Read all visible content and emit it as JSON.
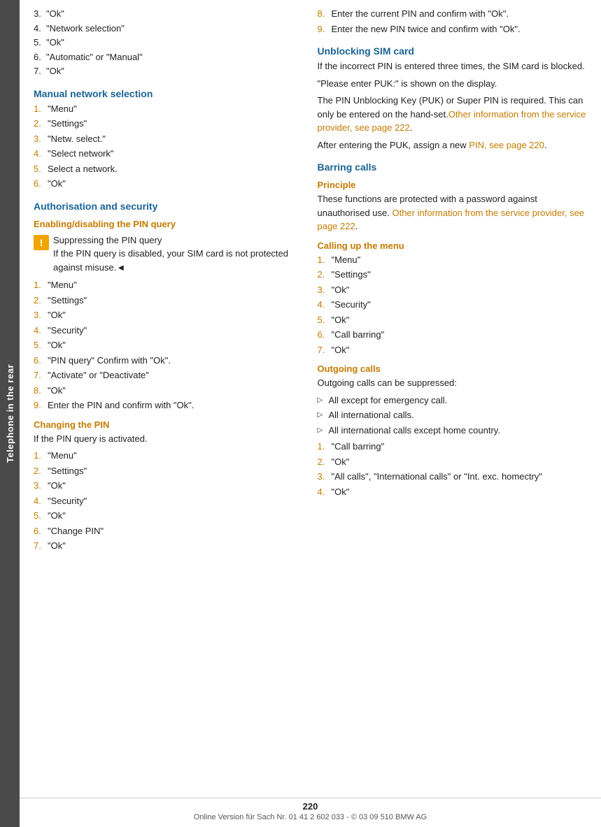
{
  "sidebar": {
    "label": "Telephone in the rear"
  },
  "footer": {
    "page_number": "220",
    "text": "Online Version für Sach Nr. 01 41 2 602 033 - © 03 09 510 BMW AG"
  },
  "left_col": {
    "top_list": {
      "items": [
        {
          "num": "3.",
          "text": "\"Ok\""
        },
        {
          "num": "4.",
          "text": "\"Network selection\""
        },
        {
          "num": "5.",
          "text": "\"Ok\""
        },
        {
          "num": "6.",
          "text": "\"Automatic\" or \"Manual\""
        },
        {
          "num": "7.",
          "text": "\"Ok\""
        }
      ]
    },
    "manual_network": {
      "heading": "Manual network selection",
      "items": [
        {
          "num": "1.",
          "text": "\"Menu\""
        },
        {
          "num": "2.",
          "text": "\"Settings\""
        },
        {
          "num": "3.",
          "text": "\"Netw. select.\""
        },
        {
          "num": "4.",
          "text": "\"Select network\""
        },
        {
          "num": "5.",
          "text": "Select a network."
        },
        {
          "num": "6.",
          "text": "\"Ok\""
        }
      ]
    },
    "auth_security": {
      "heading": "Authorisation and security"
    },
    "enabling_pin": {
      "heading": "Enabling/disabling the PIN query",
      "warning_line1": "Suppressing the PIN query",
      "warning_line2": "If the PIN query is disabled, your SIM card is not protected against misuse.◄",
      "items": [
        {
          "num": "1.",
          "text": "\"Menu\""
        },
        {
          "num": "2.",
          "text": "\"Settings\""
        },
        {
          "num": "3.",
          "text": "\"Ok\""
        },
        {
          "num": "4.",
          "text": "\"Security\""
        },
        {
          "num": "5.",
          "text": "\"Ok\""
        },
        {
          "num": "6.",
          "text": "\"PIN query\" Confirm with \"Ok\"."
        },
        {
          "num": "7.",
          "text": "\"Activate\" or \"Deactivate\""
        },
        {
          "num": "8.",
          "text": "\"Ok\""
        },
        {
          "num": "9.",
          "text": "Enter the PIN and confirm with \"Ok\"."
        }
      ]
    },
    "changing_pin": {
      "heading": "Changing the PIN",
      "intro": "If the PIN query is activated.",
      "items": [
        {
          "num": "1.",
          "text": "\"Menu\""
        },
        {
          "num": "2.",
          "text": "\"Settings\""
        },
        {
          "num": "3.",
          "text": "\"Ok\""
        },
        {
          "num": "4.",
          "text": "\"Security\""
        },
        {
          "num": "5.",
          "text": "\"Ok\""
        },
        {
          "num": "6.",
          "text": "\"Change PIN\""
        },
        {
          "num": "7.",
          "text": "\"Ok\""
        }
      ]
    }
  },
  "right_col": {
    "steps_8_9": {
      "items": [
        {
          "num": "8.",
          "text": "Enter the current PIN and confirm with \"Ok\"."
        },
        {
          "num": "9.",
          "text": "Enter the new PIN twice and confirm with \"Ok\"."
        }
      ]
    },
    "unblocking": {
      "heading": "Unblocking SIM card",
      "para1": "If the incorrect PIN is entered three times, the SIM card is blocked.",
      "para2": "\"Please enter PUK:\" is shown on the display.",
      "para3_start": "The PIN Unblocking Key (PUK) or Super PIN is required. This can only be entered on the hand-set.",
      "para3_link": "Other information from the service provider, see page 222",
      "para3_end": ".",
      "para4_start": "After entering the PUK, assign a new ",
      "para4_link": "PIN, see page 220",
      "para4_end": "."
    },
    "barring_calls": {
      "heading": "Barring calls"
    },
    "principle": {
      "heading": "Principle",
      "para1_start": "These functions are protected with a password against unauthorised use. ",
      "para1_link": "Other information from the service provider, see page 222",
      "para1_end": "."
    },
    "calling_menu": {
      "heading": "Calling up the menu",
      "items": [
        {
          "num": "1.",
          "text": "\"Menu\""
        },
        {
          "num": "2.",
          "text": "\"Settings\""
        },
        {
          "num": "3.",
          "text": "\"Ok\""
        },
        {
          "num": "4.",
          "text": "\"Security\""
        },
        {
          "num": "5.",
          "text": "\"Ok\""
        },
        {
          "num": "6.",
          "text": "\"Call barring\""
        },
        {
          "num": "7.",
          "text": "\"Ok\""
        }
      ]
    },
    "outgoing_calls": {
      "heading": "Outgoing calls",
      "intro": "Outgoing calls can be suppressed:",
      "bullets": [
        "All except for emergency call.",
        "All international calls.",
        "All international calls except home country."
      ],
      "items": [
        {
          "num": "1.",
          "text": "\"Call barring\""
        },
        {
          "num": "2.",
          "text": "\"Ok\""
        },
        {
          "num": "3.",
          "text": "\"All calls\", \"International calls\" or \"Int. exc. homectry\""
        },
        {
          "num": "4.",
          "text": "\"Ok\""
        }
      ]
    }
  }
}
